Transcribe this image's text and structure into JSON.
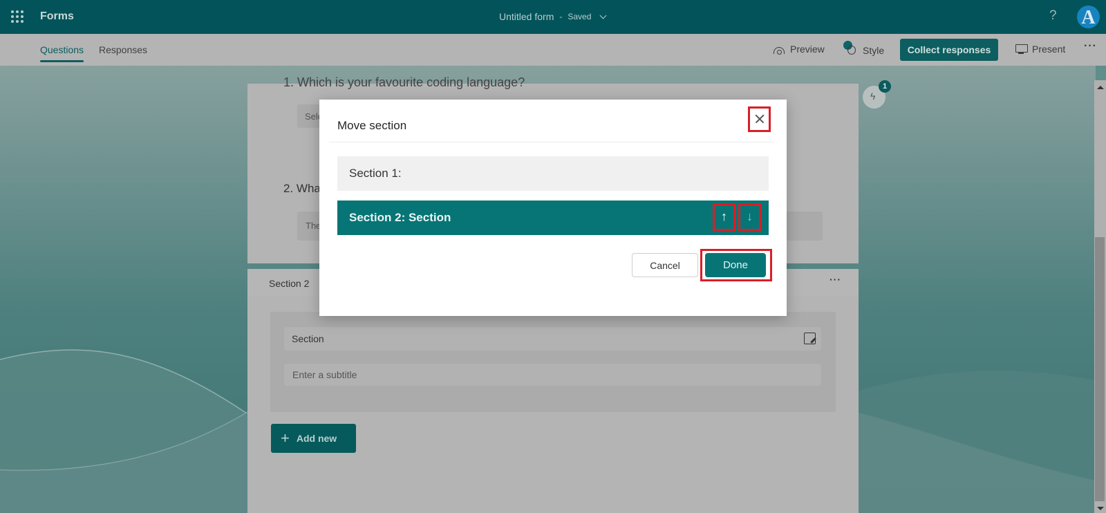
{
  "appbar": {
    "app_name": "Forms",
    "form_title": "Untitled form",
    "separator": "-",
    "save_status": "Saved",
    "help_label": "?",
    "avatar_initial": "A"
  },
  "cmdbar": {
    "tabs": [
      {
        "label": "Questions",
        "active": true
      },
      {
        "label": "Responses",
        "active": false
      }
    ],
    "preview_label": "Preview",
    "style_label": "Style",
    "collect_label": "Collect responses",
    "present_label": "Present",
    "more_label": "···"
  },
  "form": {
    "question1": "1. Which is your favourite coding language?",
    "question1_select": "Sele",
    "question2": "2. Wha",
    "question2_answer": "The",
    "section2_label": "Section 2",
    "section2_more": "···",
    "section_title_value": "Section",
    "subtitle_placeholder": "Enter a subtitle",
    "add_new_label": "Add new",
    "ideas_badge_count": "1"
  },
  "dialog": {
    "title": "Move section",
    "sections": [
      {
        "label": "Section 1:",
        "selected": false
      },
      {
        "label": "Section 2: Section",
        "selected": true
      }
    ],
    "move_up_glyph": "↑",
    "move_down_glyph": "↓",
    "cancel_label": "Cancel",
    "done_label": "Done"
  },
  "colors": {
    "brand": "#02545a",
    "accent": "#077576",
    "highlight": "#d81f27"
  }
}
